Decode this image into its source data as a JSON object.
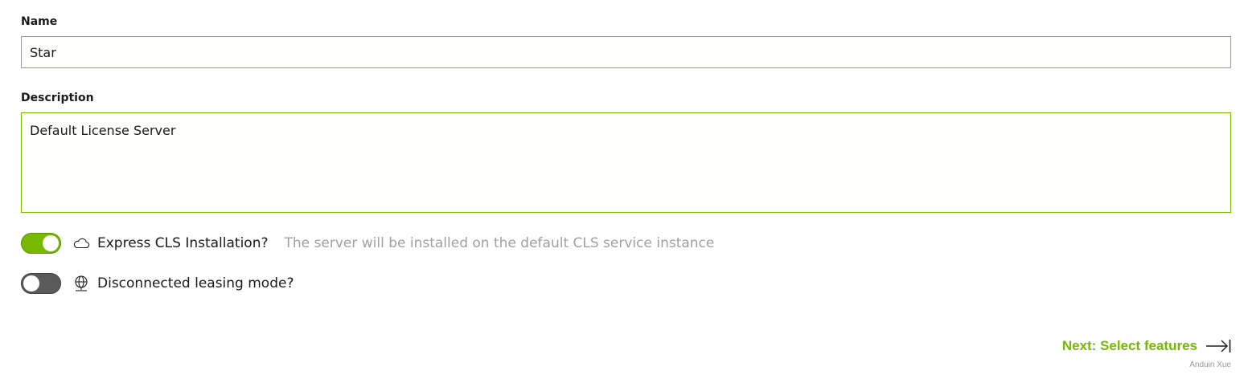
{
  "form": {
    "name": {
      "label": "Name",
      "value": "Star"
    },
    "description": {
      "label": "Description",
      "value": "Default License Server"
    },
    "express": {
      "enabled": true,
      "icon": "cloud-icon",
      "label": "Express CLS Installation?",
      "hint": "The server will be installed on the default CLS service instance"
    },
    "disconnected": {
      "enabled": false,
      "icon": "globe-icon",
      "label": "Disconnected leasing mode?"
    },
    "next": {
      "label": "Next: Select features",
      "icon": "arrow-right-to-bar-icon"
    },
    "credit": "Anduin Xue"
  },
  "colors": {
    "accent": "#76b900",
    "toggle_off": "#5a5a5a",
    "hint_text": "#a0a0a0"
  }
}
